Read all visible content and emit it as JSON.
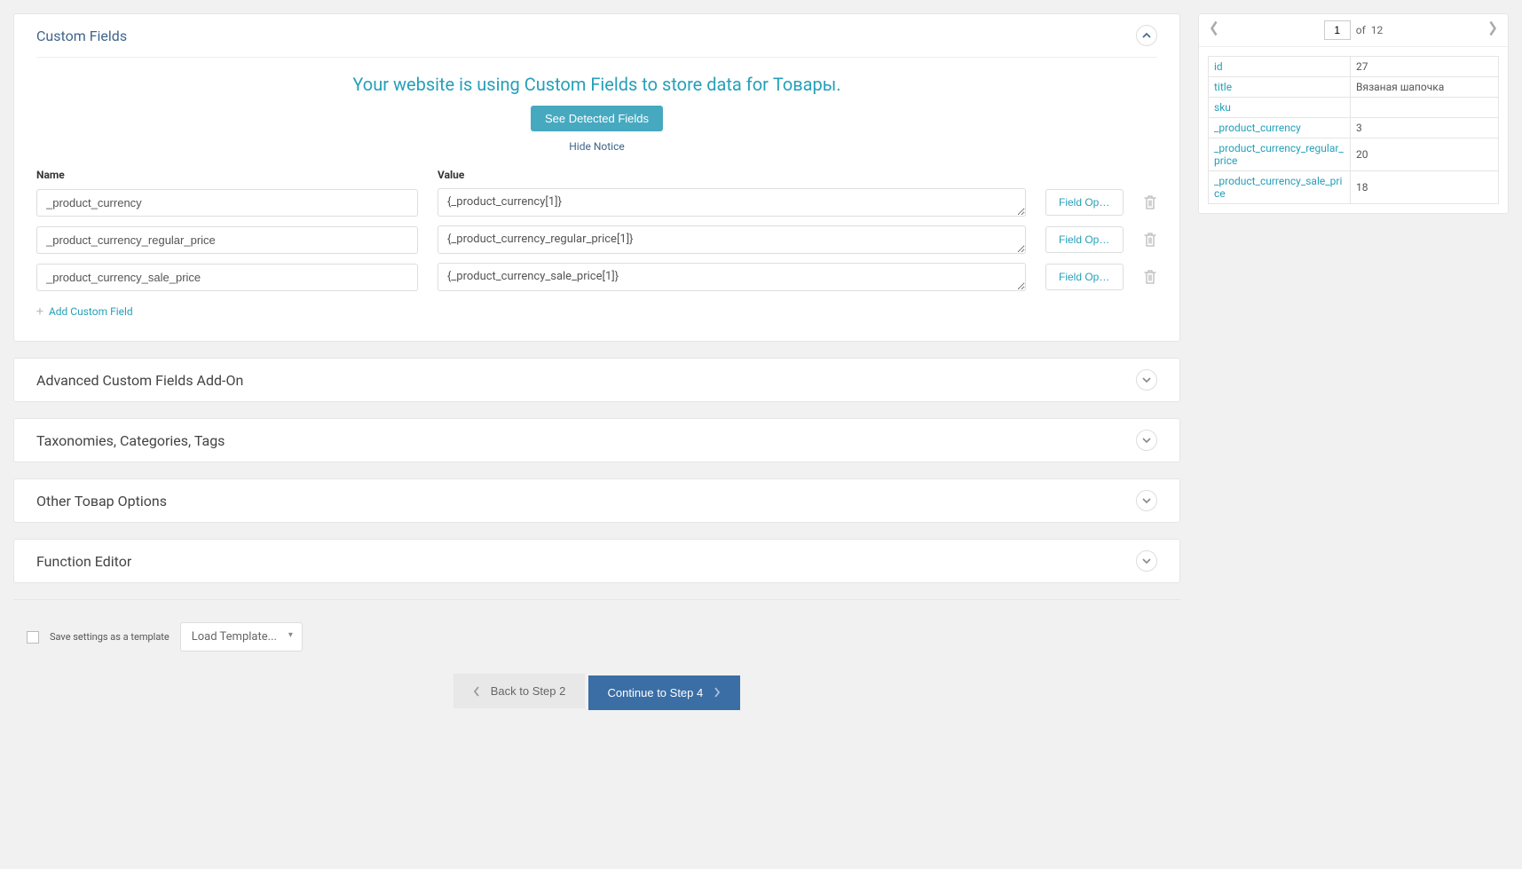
{
  "customFields": {
    "title": "Custom Fields",
    "noticeMsg": "Your website is using Custom Fields to store data for Товары.",
    "seeDetectedBtn": "See Detected Fields",
    "hideNotice": "Hide Notice",
    "nameHeader": "Name",
    "valueHeader": "Value",
    "rows": [
      {
        "name": "_product_currency",
        "value": "{_product_currency[1]}",
        "opts": "Field Options..."
      },
      {
        "name": "_product_currency_regular_price",
        "value": "{_product_currency_regular_price[1]}",
        "opts": "Field Options..."
      },
      {
        "name": "_product_currency_sale_price",
        "value": "{_product_currency_sale_price[1]}",
        "opts": "Field Options..."
      }
    ],
    "addLink": "Add Custom Field"
  },
  "collapsedPanels": [
    {
      "title": "Advanced Custom Fields Add-On"
    },
    {
      "title": "Taxonomies, Categories, Tags"
    },
    {
      "title": "Other Товар Options"
    },
    {
      "title": "Function Editor"
    }
  ],
  "templateBar": {
    "saveLabel": "Save settings as a template",
    "loadLabel": "Load Template..."
  },
  "navButtons": {
    "back": "Back to Step 2",
    "continue": "Continue to Step 4"
  },
  "preview": {
    "page": "1",
    "of": "of",
    "total": "12",
    "rows": [
      {
        "k": "id",
        "v": "27"
      },
      {
        "k": "title",
        "v": "Вязаная шапочка"
      },
      {
        "k": "sku",
        "v": ""
      },
      {
        "k": "_product_currency",
        "v": "3"
      },
      {
        "k": "_product_currency_regular_price",
        "v": "20"
      },
      {
        "k": "_product_currency_sale_price",
        "v": "18"
      }
    ]
  }
}
